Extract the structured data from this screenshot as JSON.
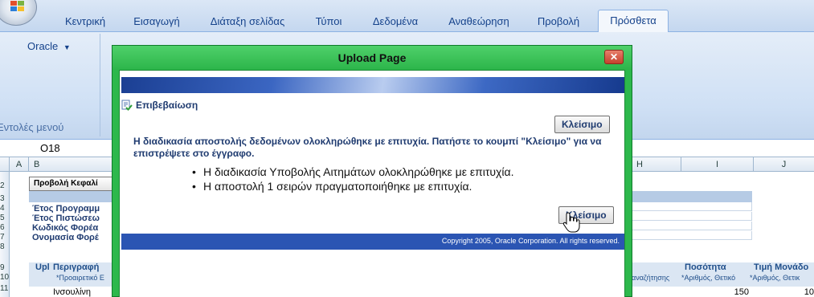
{
  "ribbon": {
    "tabs": [
      "Κεντρική",
      "Εισαγωγή",
      "Διάταξη σελίδας",
      "Τύποι",
      "Δεδομένα",
      "Αναθεώρηση",
      "Προβολή",
      "Πρόσθετα"
    ],
    "active_tab": "Πρόσθετα",
    "oracle_menu": "Oracle",
    "group_label": "Εντολές μενού"
  },
  "formula_bar": {
    "name_box": "O18"
  },
  "sheet": {
    "columns": [
      "A",
      "B",
      "H",
      "I",
      "J"
    ],
    "rows": [
      "2",
      "3",
      "4",
      "5",
      "6",
      "7",
      "8",
      "9",
      "10",
      "11"
    ],
    "header_button": "Προβολή Κεφαλί",
    "labels": [
      "Έτος Προγραμμ",
      "Έτος Πιστώσεω",
      "Κωδικός Φορέα",
      "Ονομασία Φορέ"
    ],
    "upl": "Upl",
    "description_header": "Περιγραφή",
    "description_hint": "*Προαιρετικό Ε",
    "h_hint": "αναζήτησης",
    "quantity_header": "Ποσότητα",
    "quantity_hint": "*Αριθμός, Θετικό",
    "unit_price_header": "Τιμή Μονάδο",
    "unit_price_hint": "*Αριθμός, Θετικ",
    "first_item": "Ινσουλίνη",
    "first_quantity": "150",
    "first_unit_price": "10"
  },
  "dialog": {
    "title": "Upload Page",
    "close_icon": "close-icon",
    "confirmation_title": "Επιβεβαίωση",
    "close_button": "Κλείσιμο",
    "message": "Η διαδικασία αποστολής δεδομένων ολοκληρώθηκε με επιτυχία. Πατήστε το κουμπί \"Κλείσιμο\" για να επιστρέψετε στο έγγραφο.",
    "bullets": [
      "Η διαδικασία Υποβολής Αιτημάτων ολοκληρώθηκε με επιτυχία.",
      "Η αποστολή 1 σειρών πραγματοποιήθηκε με επιτυχία."
    ],
    "copyright": "Copyright 2005, Oracle Corporation. All rights reserved."
  },
  "colors": {
    "dialog_frame": "#2db84c",
    "banner_blue": "#2b55b3",
    "ribbon_text": "#15428b"
  }
}
